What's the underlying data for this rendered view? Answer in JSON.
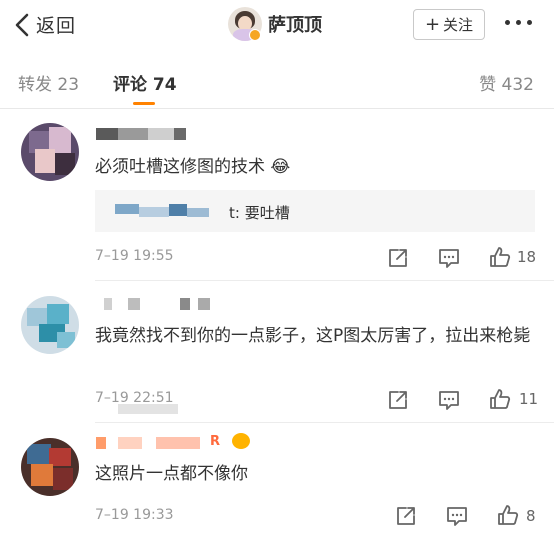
{
  "nav": {
    "back_label": "返回",
    "user_name": "萨顶顶",
    "follow_label": "关注",
    "follow_icon": "plus-icon",
    "more_icon": "more-dots-icon"
  },
  "tabs": {
    "forward": "转发 23",
    "comment": "评论 74",
    "like": "赞 432",
    "accent": "#ff8200"
  },
  "comments": [
    {
      "text": "必须吐槽这修图的技术 😂",
      "reply_text": "t: 要吐槽",
      "time": "7–19 19:55",
      "likes": "18"
    },
    {
      "text": "我竟然找不到你的一点影子，这P图太厉害了，拉出来枪毙",
      "time": "7–19 22:51",
      "likes": "11"
    },
    {
      "text": "这照片一点都不像你",
      "name_suffix": "R",
      "time": "7–19 19:33",
      "likes": "8"
    }
  ]
}
